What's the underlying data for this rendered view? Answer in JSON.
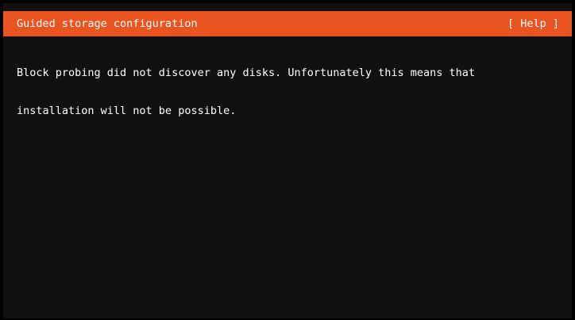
{
  "header": {
    "title": "Guided storage configuration",
    "help_label": "[ Help ]"
  },
  "message": {
    "line1": "Block probing did not discover any disks. Unfortunately this means that",
    "line2": "installation will not be possible."
  },
  "colors": {
    "accent": "#E95420",
    "background": "#111111",
    "frame": "#000000",
    "text": "#FFFFFF"
  }
}
